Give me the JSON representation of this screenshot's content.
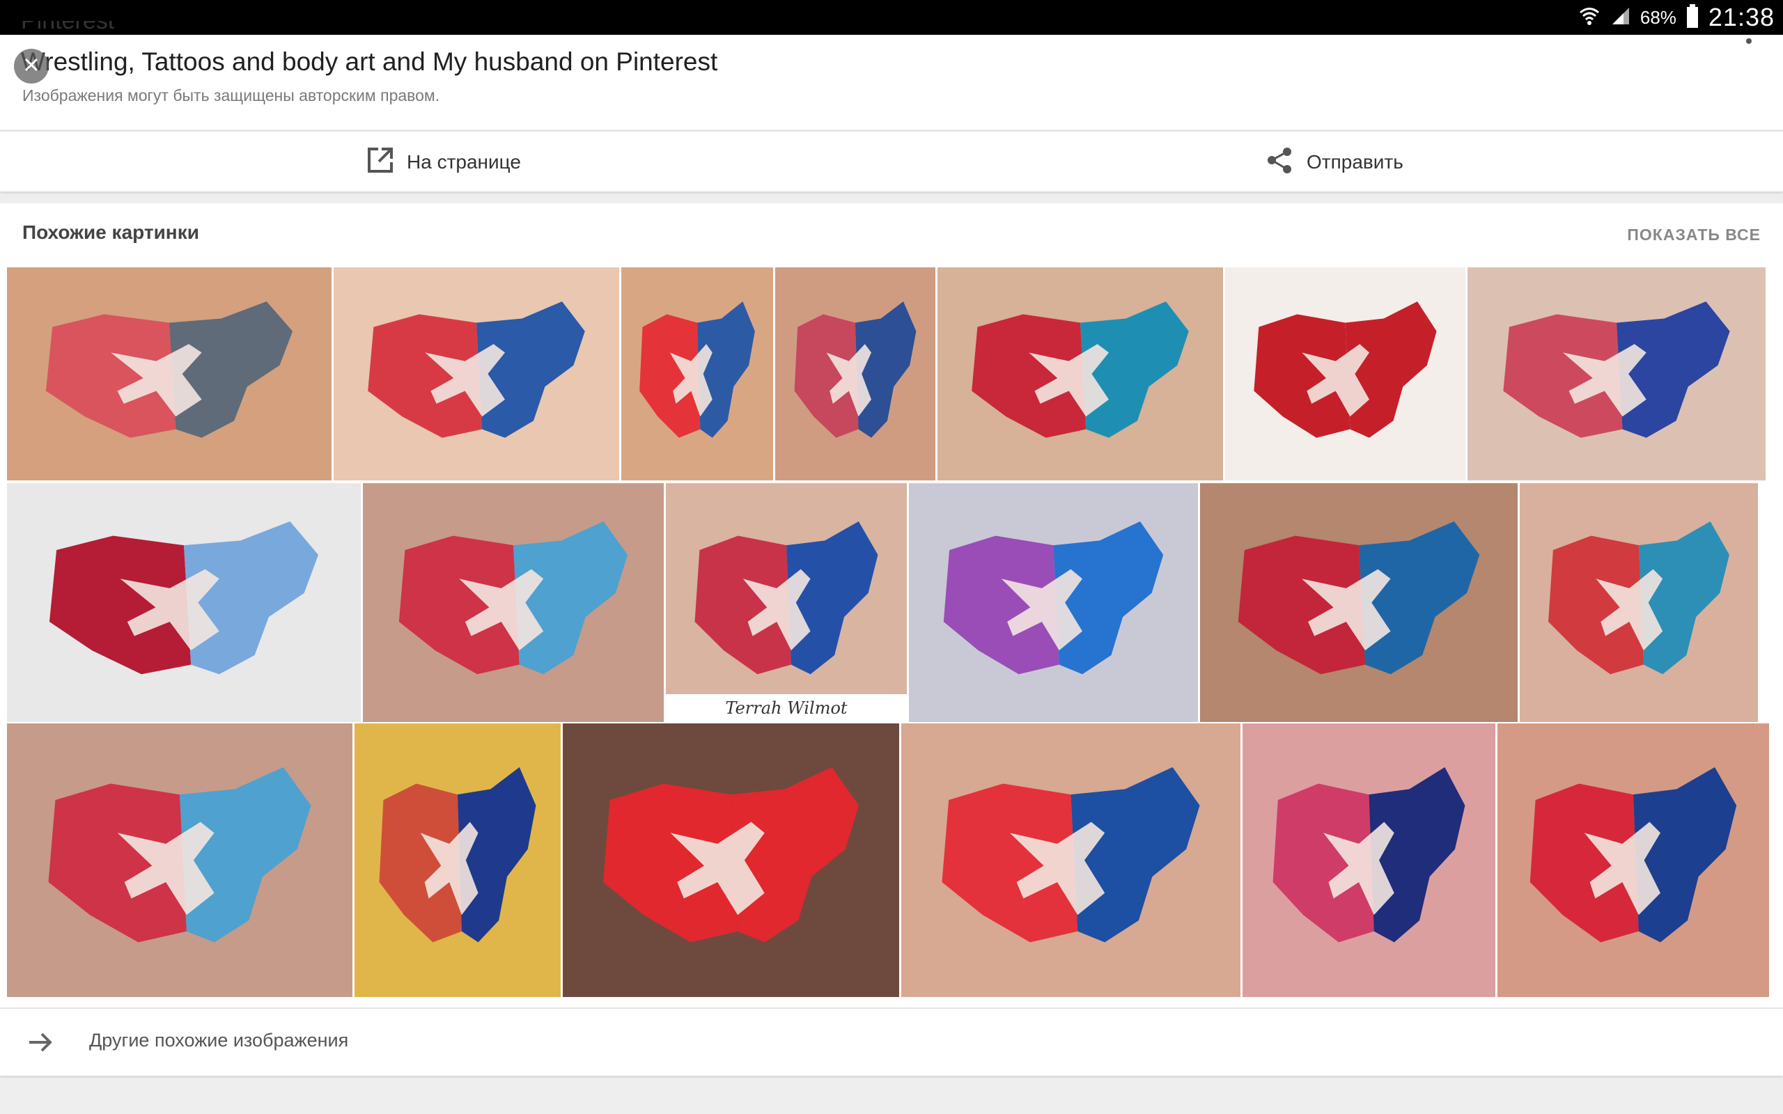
{
  "status": {
    "battery_pct": "68%",
    "time": "21:38"
  },
  "header": {
    "cut_text": "Pinterest",
    "title": "Wrestling, Tattoos and body art and My husband on Pinterest",
    "subtitle": "Изображения могут быть защищены авторским правом."
  },
  "actions": {
    "open_label": "На странице",
    "share_label": "Отправить"
  },
  "similar": {
    "title": "Похожие картинки",
    "show_all": "ПОКАЗАТЬ ВСЕ",
    "images": [
      {
        "row": 0,
        "subject": "usa-map-wrestler-tattoo",
        "bg": "#d4a07e",
        "left": "#d9545c",
        "right": "#5f6b78"
      },
      {
        "row": 0,
        "subject": "usa-map-wrestler-tattoo",
        "bg": "#e9c7b0",
        "left": "#d83a45",
        "right": "#2a5aa8"
      },
      {
        "row": 0,
        "subject": "maine-wrestler-tattoo",
        "bg": "#d9a684",
        "left": "#e5333a",
        "right": "#2d5aa5"
      },
      {
        "row": 0,
        "subject": "bear-wrestler-tattoo",
        "bg": "#cf9c82",
        "left": "#c7475d",
        "right": "#2d4f95"
      },
      {
        "row": 0,
        "subject": "ohio-wrestler-tattoo",
        "bg": "#d7b198",
        "left": "#c8283a",
        "right": "#1e8fb3"
      },
      {
        "row": 0,
        "subject": "canada-flag-tattoo",
        "bg": "#f3eeea",
        "left": "#c5202a",
        "right": "#c5202a"
      },
      {
        "row": 0,
        "subject": "veni-vidi-vici-tattoo",
        "bg": "#dcc1b2",
        "left": "#cd4a5e",
        "right": "#2b45a0"
      },
      {
        "row": 1,
        "subject": "usa-map-wrestler-cake",
        "bg": "#e8e8e8",
        "left": "#b51c35",
        "right": "#79a8dc"
      },
      {
        "row": 1,
        "subject": "usa-map-wrestler-tattoo",
        "bg": "#c69b8a",
        "left": "#cf3348",
        "right": "#4fa1cf"
      },
      {
        "row": 1,
        "subject": "usa-wrestling-tattoo",
        "bg": "#d9b4a1",
        "left": "#c9334a",
        "right": "#2550a8",
        "caption": "Terrah Wilmot"
      },
      {
        "row": 1,
        "subject": "usa-map-wrestler-tattoo",
        "bg": "#c9c9d6",
        "left": "#9a4db6",
        "right": "#2673d0"
      },
      {
        "row": 1,
        "subject": "superman-shield-tattoo",
        "bg": "#b4876e",
        "left": "#c3263a",
        "right": "#1f66a6"
      },
      {
        "row": 1,
        "subject": "colorado-wrestler-tattoo",
        "bg": "#d9b09e",
        "left": "#d13a3e",
        "right": "#2d8fb6"
      },
      {
        "row": 2,
        "subject": "usa-map-wrestler-tattoo",
        "bg": "#c69b8a",
        "left": "#cf3348",
        "right": "#4fa1cf"
      },
      {
        "row": 2,
        "subject": "tribal-back-tattoo",
        "bg": "#e0b64a",
        "left": "#cf4e3a",
        "right": "#1f3a8c"
      },
      {
        "row": 2,
        "subject": "red-wrestler-tattoo",
        "bg": "#6e4a3e",
        "left": "#e0282e",
        "right": "#e0282e"
      },
      {
        "row": 2,
        "subject": "usa-map-wrestler-tattoo",
        "bg": "#d7a892",
        "left": "#e3323b",
        "right": "#1d4fa2"
      },
      {
        "row": 2,
        "subject": "usa-map-wrestler-tattoo",
        "bg": "#dc9fa0",
        "left": "#d03c68",
        "right": "#1f2d7a"
      },
      {
        "row": 2,
        "subject": "usa-map-wrestler-tattoo",
        "bg": "#d59a85",
        "left": "#d6283a",
        "right": "#1d3f8f"
      }
    ],
    "more_label": "Другие похожие изображения"
  }
}
